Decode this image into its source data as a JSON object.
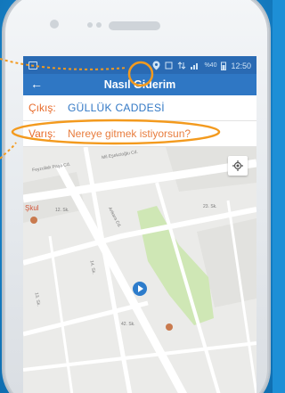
{
  "statusbar": {
    "signal": "%40",
    "time": "12:50"
  },
  "appbar": {
    "title": "Nasıl Giderim"
  },
  "origin": {
    "label": "Çıkış:",
    "value": "GÜLLÜK CADDESİ"
  },
  "destination": {
    "label": "Varış:",
    "placeholder": "Nereye gitmek istiyorsun?"
  },
  "map": {
    "streets": [
      "Feyzullah Paşa Cd.",
      "Mil Eşekcioğlu Cd.",
      "Ankara Cd.",
      "12. Sk.",
      "13. Sk.",
      "14. Sk.",
      "42. Sk.",
      "23. Sk."
    ],
    "poi": "Şkul"
  },
  "colors": {
    "accent": "#f39a1e",
    "appbar": "#2f77c4",
    "statusbar": "#2a6ab3",
    "label": "#e86b2a",
    "value": "#3278c5"
  }
}
